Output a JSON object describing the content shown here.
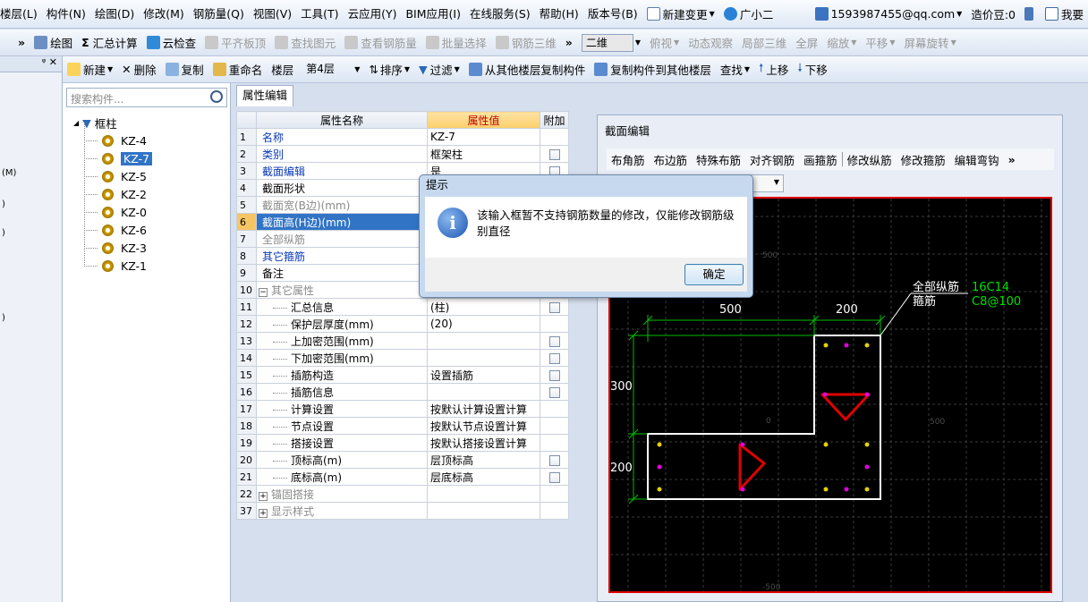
{
  "menubar": {
    "items": [
      "楼层(L)",
      "构件(N)",
      "绘图(D)",
      "修改(M)",
      "钢筋量(Q)",
      "视图(V)",
      "工具(T)",
      "云应用(Y)",
      "BIM应用(I)",
      "在线服务(S)",
      "帮助(H)",
      "版本号(B)"
    ],
    "new_change": "新建变更",
    "guang_xiao_er": "广小二",
    "account": "1593987455@qq.com",
    "cost_beans": "造价豆:0",
    "my": "我要"
  },
  "toolbar1": {
    "draw": "绘图",
    "sum": "汇总计算",
    "cloud_check": "云检查",
    "flat_top": "平齐板顶",
    "find_elem": "查找图元",
    "view_rebar": "查看钢筋量",
    "batch_select": "批量选择",
    "rebar_3d": "钢筋三维",
    "view_2d": "二维",
    "top_view": "俯视",
    "dynamic_view": "动态观察",
    "local_3d": "局部三维",
    "fullscreen": "全屏",
    "zoom": "缩放",
    "pan": "平移",
    "rotate": "屏幕旋转"
  },
  "toolbar2": {
    "new": "新建",
    "delete": "删除",
    "copy": "复制",
    "rename": "重命名",
    "floor_label": "楼层",
    "floor_value": "第4层",
    "sort": "排序",
    "filter": "过滤",
    "copy_from": "从其他楼层复制构件",
    "copy_to": "复制构件到其他楼层",
    "find": "查找",
    "move_up": "上移",
    "move_down": "下移"
  },
  "leftstrip": {
    "labels": [
      "(M)",
      ")",
      ")",
      ")"
    ]
  },
  "tree": {
    "search_placeholder": "搜索构件...",
    "root": "框柱",
    "items": [
      "KZ-4",
      "KZ-7",
      "KZ-5",
      "KZ-2",
      "KZ-0",
      "KZ-6",
      "KZ-3",
      "KZ-1"
    ],
    "selected": "KZ-7"
  },
  "properties": {
    "tab": "属性编辑",
    "headers": [
      "属性名称",
      "属性值",
      "附加"
    ],
    "rows": [
      {
        "n": "1",
        "name": "名称",
        "value": "KZ-7"
      },
      {
        "n": "2",
        "name": "类别",
        "value": "框架柱"
      },
      {
        "n": "3",
        "name": "截面编辑",
        "value": "是"
      },
      {
        "n": "4",
        "name": "截面形状",
        "value": ""
      },
      {
        "n": "5",
        "name": "截面宽(B边)(mm)",
        "value": ""
      },
      {
        "n": "6",
        "name": "截面高(H边)(mm)",
        "value": ""
      },
      {
        "n": "7",
        "name": "全部纵筋",
        "value": ""
      },
      {
        "n": "8",
        "name": "其它箍筋",
        "value": ""
      },
      {
        "n": "9",
        "name": "备注",
        "value": ""
      },
      {
        "n": "10",
        "name": "其它属性",
        "value": ""
      },
      {
        "n": "11",
        "name": "汇总信息",
        "value": "(柱)"
      },
      {
        "n": "12",
        "name": "保护层厚度(mm)",
        "value": "(20)"
      },
      {
        "n": "13",
        "name": "上加密范围(mm)",
        "value": ""
      },
      {
        "n": "14",
        "name": "下加密范围(mm)",
        "value": ""
      },
      {
        "n": "15",
        "name": "插筋构造",
        "value": "设置插筋"
      },
      {
        "n": "16",
        "name": "插筋信息",
        "value": ""
      },
      {
        "n": "17",
        "name": "计算设置",
        "value": "按默认计算设置计算"
      },
      {
        "n": "18",
        "name": "节点设置",
        "value": "按默认节点设置计算"
      },
      {
        "n": "19",
        "name": "搭接设置",
        "value": "按默认搭接设置计算"
      },
      {
        "n": "20",
        "name": "顶标高(m)",
        "value": "层顶标高"
      },
      {
        "n": "21",
        "name": "底标高(m)",
        "value": "层底标高"
      },
      {
        "n": "22",
        "name": "锚固搭接",
        "value": ""
      },
      {
        "n": "37",
        "name": "显示样式",
        "value": ""
      }
    ]
  },
  "section_editor": {
    "title": "截面编辑",
    "tools": [
      "布角筋",
      "布边筋",
      "特殊布筋",
      "对齐钢筋",
      "画箍筋",
      "修改纵筋",
      "修改箍筋",
      "编辑弯钩"
    ],
    "all_longitudinal_label": "全部纵筋",
    "stirrup_label": "箍筋",
    "all_longitudinal_value": "16C14",
    "stirrup_value": "C8@100",
    "dims_top": [
      "500",
      "200"
    ],
    "dims_left": [
      "300",
      "200"
    ],
    "axis_labels": [
      "500",
      "0",
      "500",
      "-500"
    ]
  },
  "dialog": {
    "title": "提示",
    "message": "该输入框暂不支持钢筋数量的修改，仅能修改钢筋级别直径",
    "ok": "确定"
  }
}
